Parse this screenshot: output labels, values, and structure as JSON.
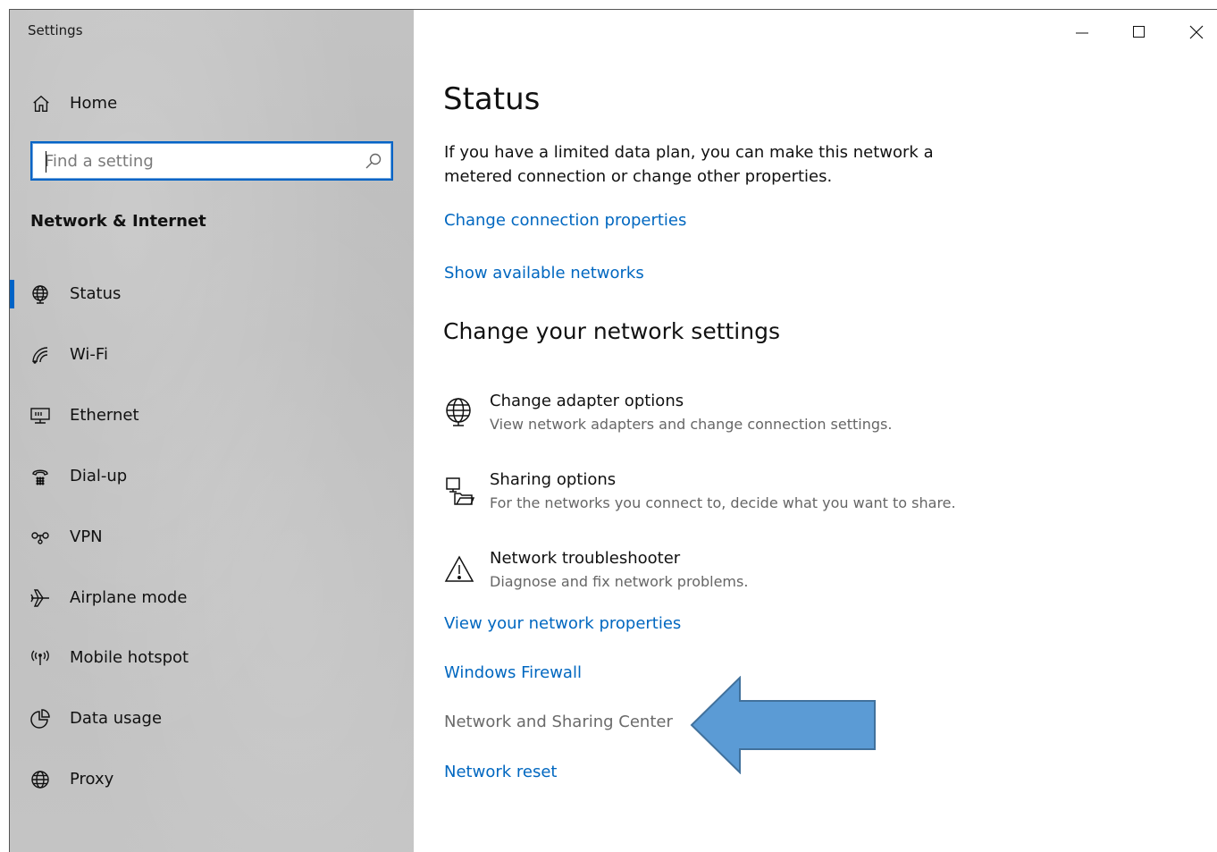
{
  "window": {
    "title": "Settings",
    "controls": [
      "minimize",
      "maximize",
      "close"
    ]
  },
  "sidebar": {
    "home_label": "Home",
    "search": {
      "value": "",
      "placeholder": "Find a setting"
    },
    "section_title": "Network & Internet",
    "items": [
      {
        "label": "Status",
        "icon": "globe-status-icon",
        "selected": true
      },
      {
        "label": "Wi-Fi",
        "icon": "wifi-icon",
        "selected": false
      },
      {
        "label": "Ethernet",
        "icon": "ethernet-icon",
        "selected": false
      },
      {
        "label": "Dial-up",
        "icon": "dialup-icon",
        "selected": false
      },
      {
        "label": "VPN",
        "icon": "vpn-icon",
        "selected": false
      },
      {
        "label": "Airplane mode",
        "icon": "airplane-icon",
        "selected": false
      },
      {
        "label": "Mobile hotspot",
        "icon": "hotspot-icon",
        "selected": false
      },
      {
        "label": "Data usage",
        "icon": "data-usage-icon",
        "selected": false
      },
      {
        "label": "Proxy",
        "icon": "globe-icon",
        "selected": false
      }
    ]
  },
  "main": {
    "title": "Status",
    "intro": "If you have a limited data plan, you can make this network a metered connection or change other properties.",
    "links_top": [
      "Change connection properties",
      "Show available networks"
    ],
    "subheading": "Change your network settings",
    "options": [
      {
        "title": "Change adapter options",
        "desc": "View network adapters and change connection settings.",
        "icon": "adapter-icon"
      },
      {
        "title": "Sharing options",
        "desc": "For the networks you connect to, decide what you want to share.",
        "icon": "sharing-icon"
      },
      {
        "title": "Network troubleshooter",
        "desc": "Diagnose and fix network problems.",
        "icon": "warning-icon"
      }
    ],
    "links_bottom": [
      "View your network properties",
      "Windows Firewall",
      "Network and Sharing Center",
      "Network reset"
    ]
  },
  "colors": {
    "accent": "#0063c6",
    "link": "#0067c0",
    "arrow_fill": "#5b9bd5",
    "arrow_stroke": "#41719c"
  }
}
